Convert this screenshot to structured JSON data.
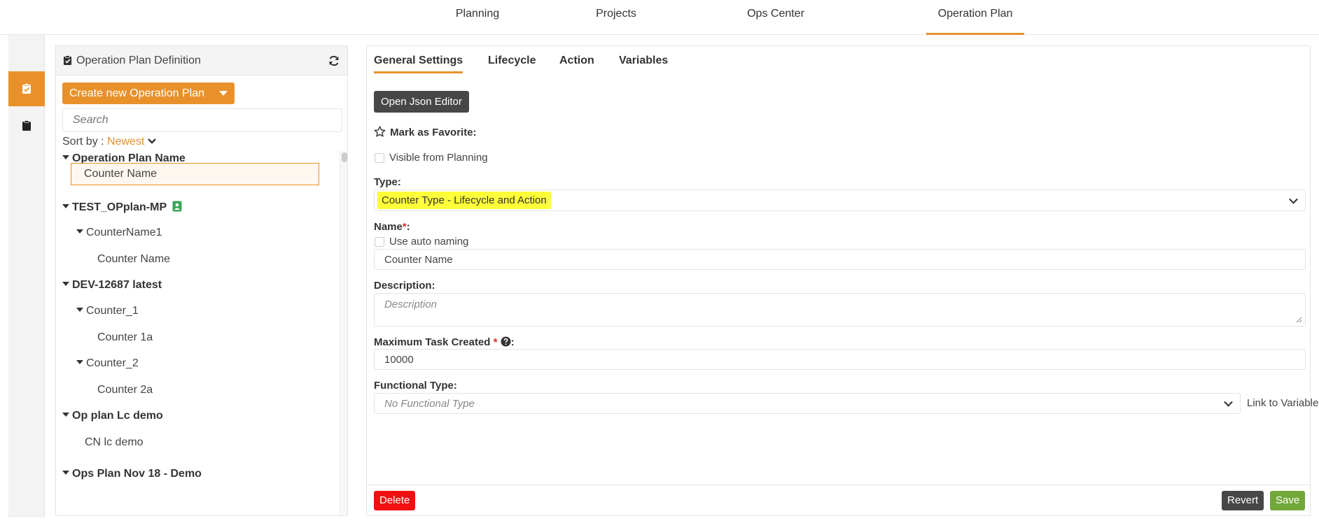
{
  "nav": {
    "items": [
      "Planning",
      "Projects",
      "Ops Center",
      "Operation Plan"
    ],
    "active": "Operation Plan",
    "accent": "#e8912b"
  },
  "rail": {
    "items": [
      {
        "icon": "clipboard-check-icon",
        "active": true
      },
      {
        "icon": "clipboard-icon",
        "active": false
      }
    ]
  },
  "definition_panel": {
    "title": "Operation Plan Definition",
    "create_label": "Create new Operation Plan",
    "search_placeholder": "Search",
    "sort_label": "Sort by :",
    "sort_value": "Newest",
    "tree": [
      {
        "label": "Operation Plan Name",
        "level": 0,
        "expandable": true
      },
      {
        "label": "Counter Name",
        "level": 1,
        "expandable": false,
        "selected": true
      },
      {
        "label": "TEST_OPplan-MP",
        "level": 0,
        "expandable": true,
        "badge": "user-badge-icon"
      },
      {
        "label": "CounterName1",
        "level": 1,
        "expandable": true
      },
      {
        "label": "Counter Name",
        "level": 2,
        "expandable": false
      },
      {
        "label": "DEV-12687 latest",
        "level": 0,
        "expandable": true
      },
      {
        "label": "Counter_1",
        "level": 1,
        "expandable": true
      },
      {
        "label": "Counter 1a",
        "level": 2,
        "expandable": false
      },
      {
        "label": "Counter_2",
        "level": 1,
        "expandable": true
      },
      {
        "label": "Counter 2a",
        "level": 2,
        "expandable": false
      },
      {
        "label": "Op plan Lc demo",
        "level": 0,
        "expandable": true
      },
      {
        "label": "CN lc demo",
        "level": 1,
        "expandable": false
      },
      {
        "label": "Ops Plan Nov 18 - Demo",
        "level": 0,
        "expandable": true
      }
    ]
  },
  "main": {
    "tabs": [
      "General Settings",
      "Lifecycle",
      "Action",
      "Variables"
    ],
    "active_tab": "General Settings",
    "json_button": "Open Json Editor",
    "favorite_label": "Mark as Favorite:",
    "visible_label": "Visible from Planning",
    "type_label": "Type:",
    "type_value": "Counter Type - Lifecycle and Action",
    "name_label": "Name",
    "name_req": "*",
    "name_suffix": ":",
    "auto_naming_label": "Use auto naming",
    "name_value": "Counter Name",
    "description_label": "Description:",
    "description_placeholder": "Description",
    "max_task_label": "Maximum Task Created",
    "max_task_req": "*",
    "max_task_suffix": ":",
    "max_task_value": "10000",
    "functional_type_label": "Functional Type:",
    "functional_type_value": "No Functional Type",
    "link_variable_label": "Link to Variable",
    "delete_label": "Delete",
    "revert_label": "Revert",
    "save_label": "Save"
  },
  "colors": {
    "accent": "#e8912b",
    "delete": "#f20f0f",
    "revert": "#474747",
    "save": "#72a83a",
    "highlight": "#ffff3a",
    "badge": "#3aa757"
  }
}
